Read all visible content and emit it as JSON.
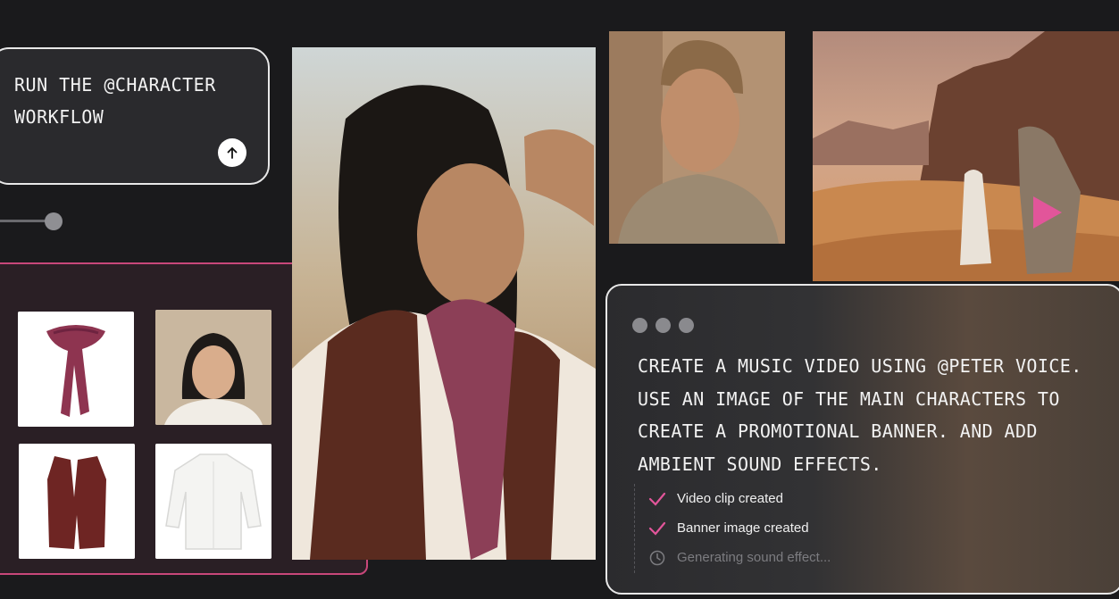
{
  "prompt": {
    "text": "RUN THE @CHARACTER WORKFLOW",
    "send_icon": "arrow-up-icon"
  },
  "slider": {
    "value": 0.05
  },
  "assets": [
    {
      "name": "scarf",
      "icon": "scarf-image"
    },
    {
      "name": "portrait",
      "icon": "woman-portrait-image"
    },
    {
      "name": "vest",
      "icon": "vest-image"
    },
    {
      "name": "shirt",
      "icon": "shirt-image"
    }
  ],
  "chat": {
    "message": "CREATE A MUSIC VIDEO USING @PETER VOICE. USE AN IMAGE OF THE MAIN CHARACTERS TO CREATE A PROMOTIONAL BANNER. AND ADD AMBIENT SOUND EFFECTS.",
    "steps": [
      {
        "label": "Video clip created",
        "status": "done"
      },
      {
        "label": "Banner image created",
        "status": "done"
      },
      {
        "label": "Generating sound effect...",
        "status": "pending"
      }
    ]
  },
  "colors": {
    "accent": "#e2559a",
    "panel_border": "#c8477a",
    "background": "#1a1a1c"
  }
}
